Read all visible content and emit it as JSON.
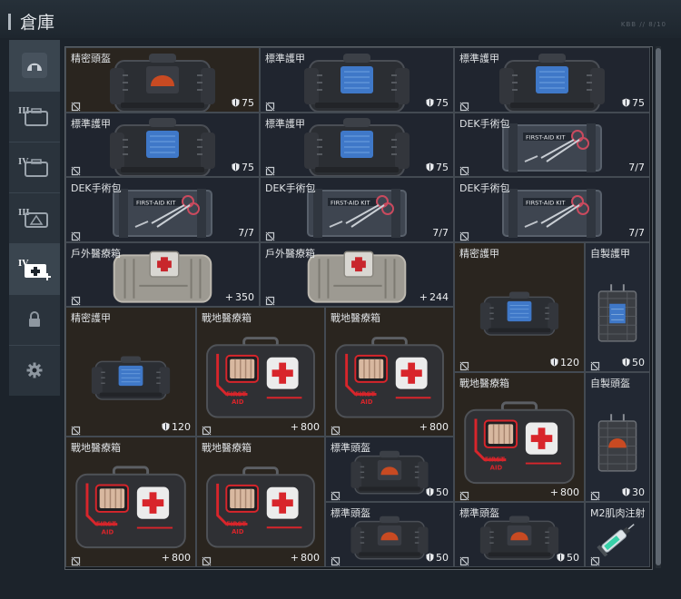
{
  "window": {
    "title": "倉庫",
    "small_text": "KBB // 8/10"
  },
  "sidebar": {
    "items": [
      {
        "name": "sidebar-helmet",
        "icon": "helmet-icon",
        "label": "",
        "active": true
      },
      {
        "name": "sidebar-tier3-case",
        "icon": "case-icon",
        "label": "III"
      },
      {
        "name": "sidebar-tier4-case",
        "icon": "case-icon",
        "label": "IV"
      },
      {
        "name": "sidebar-tier3-medbox",
        "icon": "medbox-icon",
        "label": "III"
      },
      {
        "name": "sidebar-tier4-medkit",
        "icon": "medkit-plus-icon",
        "label": "IV",
        "active": true
      },
      {
        "name": "sidebar-lock",
        "icon": "lock-icon",
        "label": ""
      },
      {
        "name": "sidebar-settings",
        "icon": "gear-icon",
        "label": ""
      }
    ]
  },
  "inventory": {
    "items": [
      {
        "name": "精密頭盔",
        "value": "75",
        "value_icon": "shield",
        "art": "armor-helmet"
      },
      {
        "name": "標準護甲",
        "value": "75",
        "value_icon": "shield",
        "art": "armor-vest"
      },
      {
        "name": "標準護甲",
        "value": "75",
        "value_icon": "shield",
        "art": "armor-vest"
      },
      {
        "name": "標準護甲",
        "value": "75",
        "value_icon": "shield",
        "art": "armor-vest"
      },
      {
        "name": "標準護甲",
        "value": "75",
        "value_icon": "shield",
        "art": "armor-vest"
      },
      {
        "name": "DEK手術包",
        "value": "7/7",
        "value_icon": "",
        "art": "surgical-kit"
      },
      {
        "name": "DEK手術包",
        "value": "7/7",
        "value_icon": "",
        "art": "surgical-kit"
      },
      {
        "name": "DEK手術包",
        "value": "7/7",
        "value_icon": "",
        "art": "surgical-kit"
      },
      {
        "name": "DEK手術包",
        "value": "7/7",
        "value_icon": "",
        "art": "surgical-kit"
      },
      {
        "name": "戶外醫療箱",
        "value": "350",
        "value_icon": "plus",
        "art": "outdoor-medkit"
      },
      {
        "name": "戶外醫療箱",
        "value": "244",
        "value_icon": "plus",
        "art": "outdoor-medkit"
      },
      {
        "name": "精密護甲",
        "value": "120",
        "value_icon": "shield",
        "art": "armor-vest"
      },
      {
        "name": "自製護甲",
        "value": "50",
        "value_icon": "shield",
        "art": "homemade-vest"
      },
      {
        "name": "精密護甲",
        "value": "120",
        "value_icon": "shield",
        "art": "armor-vest"
      },
      {
        "name": "戰地醫療箱",
        "value": "800",
        "value_icon": "plus",
        "art": "field-medkit"
      },
      {
        "name": "戰地醫療箱",
        "value": "800",
        "value_icon": "plus",
        "art": "field-medkit"
      },
      {
        "name": "戰地醫療箱",
        "value": "800",
        "value_icon": "plus",
        "art": "field-medkit"
      },
      {
        "name": "自製頭盔",
        "value": "30",
        "value_icon": "shield",
        "art": "homemade-helmet"
      },
      {
        "name": "戰地醫療箱",
        "value": "800",
        "value_icon": "plus",
        "art": "field-medkit"
      },
      {
        "name": "戰地醫療箱",
        "value": "800",
        "value_icon": "plus",
        "art": "field-medkit"
      },
      {
        "name": "標準頭盔",
        "value": "50",
        "value_icon": "shield",
        "art": "armor-helmet"
      },
      {
        "name": "標準頭盔",
        "value": "50",
        "value_icon": "shield",
        "art": "armor-helmet"
      },
      {
        "name": "標準頭盔",
        "value": "50",
        "value_icon": "shield",
        "art": "armor-helmet"
      },
      {
        "name": "M2肌肉注射",
        "value": "",
        "value_icon": "",
        "art": "syringe"
      }
    ]
  },
  "art_text": {
    "first_aid": "FIRST AID",
    "kit_label": "FIRST-AID KIT"
  },
  "colors": {
    "medkit_red": "#d8252b",
    "visor_blue": "#3f78c8",
    "visor_orange": "#c84a22",
    "tile_brown": "#2a251f",
    "tile_dark": "#20252f"
  }
}
